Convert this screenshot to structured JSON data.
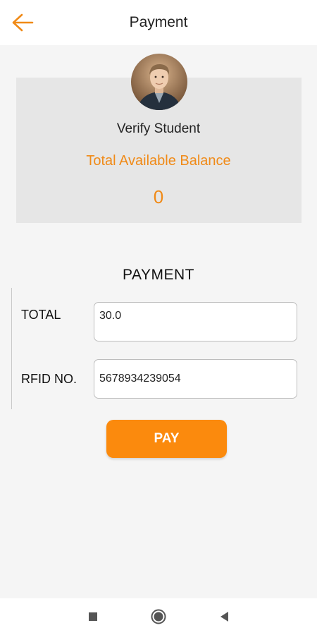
{
  "header": {
    "title": "Payment",
    "back_icon": "arrow-left-icon",
    "accent_color": "#f08a17"
  },
  "student_card": {
    "avatar_icon": "student-avatar",
    "verify_label": "Verify Student",
    "balance_label": "Total Available Balance",
    "balance_value": "0"
  },
  "payment": {
    "section_title": "PAYMENT",
    "total_label": "TOTAL",
    "total_value": "30.0",
    "rfid_label": "RFID NO.",
    "rfid_value": "5678934239054",
    "pay_button": "PAY",
    "pay_color": "#fb8a0d"
  },
  "system_nav": {
    "items": [
      "recent-apps-icon",
      "home-icon",
      "back-triangle-icon"
    ]
  }
}
